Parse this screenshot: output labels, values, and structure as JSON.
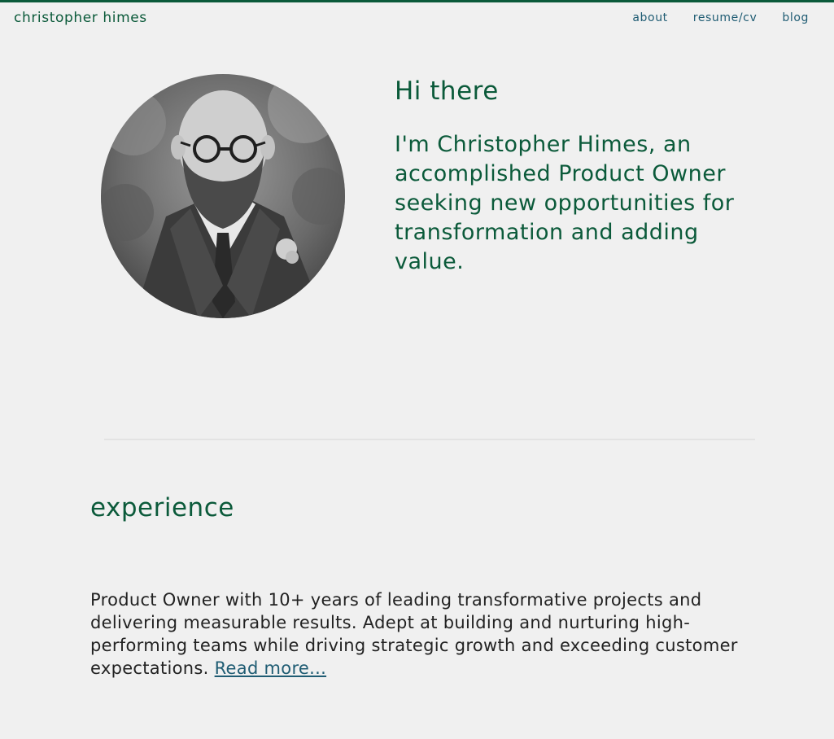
{
  "header": {
    "brand": "christopher himes",
    "nav": [
      {
        "label": "about"
      },
      {
        "label": "resume/cv"
      },
      {
        "label": "blog"
      }
    ]
  },
  "hero": {
    "greeting": "Hi there",
    "intro": "I'm Christopher Himes, an accomplished Product Owner seeking new opportunities for transformation and adding value."
  },
  "experience": {
    "title": "experience",
    "summary": "Product Owner with 10+ years of leading transformative projects and delivering measurable results. Adept at building and nurturing high-performing teams while driving strategic growth and exceeding customer expectations.",
    "read_more": "Read more..."
  },
  "colors": {
    "accent": "#0b5a3a",
    "link": "#1f5c73",
    "background": "#f0f0f0"
  }
}
